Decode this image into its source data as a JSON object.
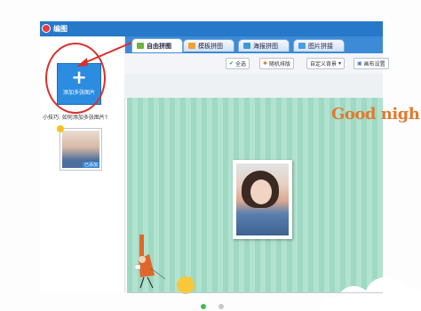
{
  "app": {
    "title": "编图"
  },
  "tabs": [
    {
      "label": "自由拼图",
      "active": true
    },
    {
      "label": "模板拼图",
      "active": false
    },
    {
      "label": "海报拼图",
      "active": false
    },
    {
      "label": "图片拼接",
      "active": false
    }
  ],
  "sidebar": {
    "add_button": {
      "plus": "+",
      "label": "添加多张图片"
    },
    "tip": "小技巧: 如何添加多张图片?",
    "thumbnail": {
      "tag": "已添加"
    }
  },
  "toolbar": {
    "select_all": "全选",
    "random_layout": "随机排版",
    "custom_background": "自定义背景",
    "canvas_settings": "画布设置"
  },
  "canvas": {
    "decor_text": "Good nigh"
  },
  "pagination": {
    "current": 1,
    "total": 2
  },
  "colors": {
    "titlebar": "#2678c9",
    "add_button": "#2b8ce0",
    "canvas_stripe": "#9fd9c3",
    "highlight": "#d9302c"
  }
}
